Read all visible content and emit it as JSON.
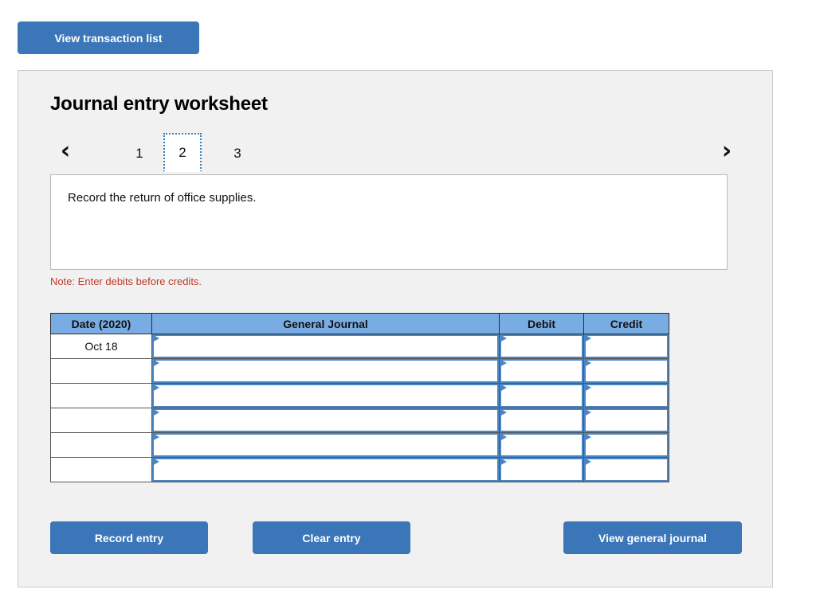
{
  "toolbar": {
    "view_transaction_list_label": "View transaction list"
  },
  "panel": {
    "title": "Journal entry worksheet",
    "pager": {
      "prev_icon": "chevron-left-icon",
      "next_icon": "chevron-right-icon",
      "prev_glyph": "‹",
      "next_glyph": "›",
      "pages": [
        "1",
        "2",
        "3"
      ],
      "active_page": "2"
    },
    "description": "Record the return of office supplies.",
    "note": "Note: Enter debits before credits.",
    "table": {
      "headers": [
        "Date (2020)",
        "General Journal",
        "Debit",
        "Credit"
      ],
      "rows": [
        {
          "date": "Oct 18",
          "general_journal": "",
          "debit": "",
          "credit": ""
        },
        {
          "date": "",
          "general_journal": "",
          "debit": "",
          "credit": ""
        },
        {
          "date": "",
          "general_journal": "",
          "debit": "",
          "credit": ""
        },
        {
          "date": "",
          "general_journal": "",
          "debit": "",
          "credit": ""
        },
        {
          "date": "",
          "general_journal": "",
          "debit": "",
          "credit": ""
        },
        {
          "date": "",
          "general_journal": "",
          "debit": "",
          "credit": ""
        }
      ]
    },
    "actions": {
      "record_entry_label": "Record entry",
      "clear_entry_label": "Clear entry",
      "view_general_journal_label": "View general journal"
    }
  },
  "colors": {
    "button_blue": "#3a76b8",
    "table_header_blue": "#79ace3",
    "field_border_blue": "#4a86c5",
    "note_red": "#c0392b",
    "panel_bg": "#f1f1f1",
    "panel_border": "#cccccc"
  }
}
